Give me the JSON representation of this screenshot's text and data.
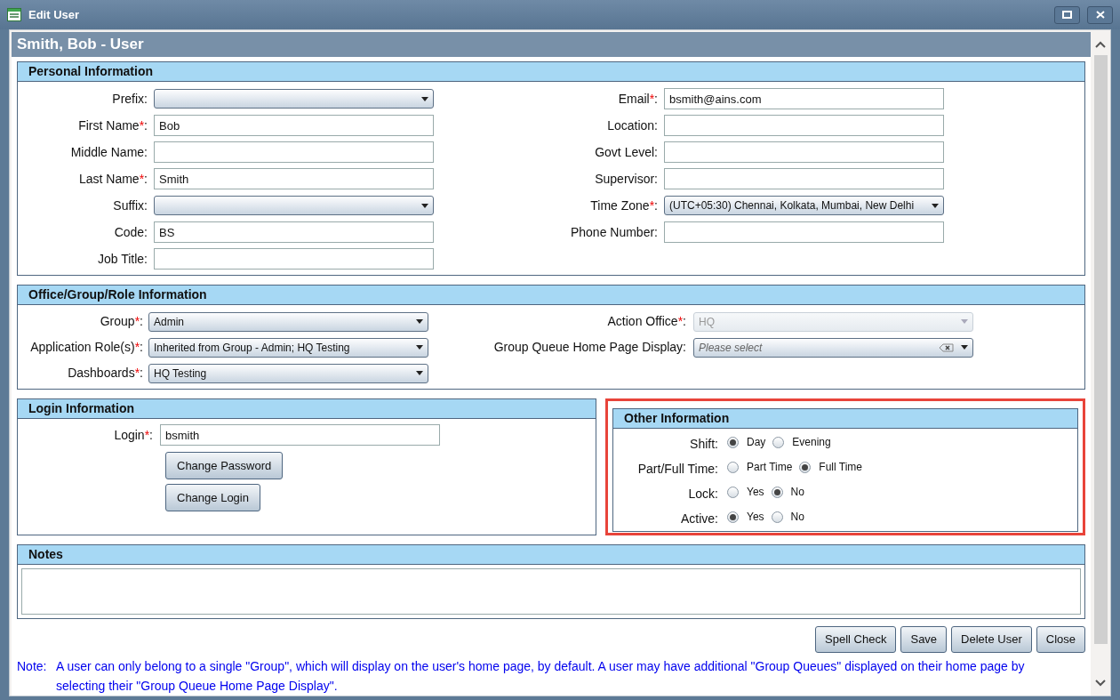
{
  "window": {
    "title": "Edit User"
  },
  "header": {
    "title": "Smith, Bob - User"
  },
  "personal": {
    "title": "Personal Information",
    "left_fields": [
      {
        "label": "Prefix:",
        "kind": "select"
      },
      {
        "label": "First Name",
        "required_mark": "*",
        "label_end": ":",
        "kind": "text",
        "value": "Bob"
      },
      {
        "label": "Middle Name:",
        "kind": "text"
      },
      {
        "label": "Last Name",
        "required_mark": "*",
        "label_end": ":",
        "kind": "text",
        "value": "Smith"
      },
      {
        "label": "Suffix:",
        "kind": "select"
      },
      {
        "label": "Code:",
        "kind": "text",
        "value": "BS"
      },
      {
        "label": "Job Title:",
        "kind": "text"
      }
    ],
    "right_fields": [
      {
        "label": "Email",
        "required_mark": "*",
        "label_end": ":",
        "kind": "text",
        "value": "bsmith@ains.com"
      },
      {
        "label": "Location:",
        "kind": "text"
      },
      {
        "label": "Govt Level:",
        "kind": "text"
      },
      {
        "label": "Supervisor:",
        "kind": "text"
      },
      {
        "label": "Time Zone",
        "required_mark": "*",
        "label_end": ":",
        "kind": "select",
        "value": "(UTC+05:30) Chennai, Kolkata, Mumbai, New Delhi"
      },
      {
        "label": "Phone Number:",
        "kind": "text"
      }
    ]
  },
  "office": {
    "title": "Office/Group/Role Information",
    "left_fields": [
      {
        "label": "Group",
        "required_mark": "*",
        "label_end": ":",
        "kind": "select",
        "value": "Admin",
        "disabled": false
      },
      {
        "label": "Application Role(s)",
        "required_mark": "*",
        "label_end": ":",
        "kind": "select",
        "value": "Inherited from Group - Admin; HQ Testing",
        "disabled": false
      },
      {
        "label": "Dashboards",
        "required_mark": "*",
        "label_end": ":",
        "kind": "select",
        "value": "HQ Testing",
        "disabled": false
      }
    ],
    "right_fields": [
      {
        "label": "Action Office",
        "required_mark": "*",
        "label_end": ":",
        "kind": "select",
        "value": "HQ",
        "disabled": true
      },
      {
        "label": "Group Queue Home Page Display:",
        "kind": "clearable",
        "placeholder": "Please select",
        "disabled": false
      }
    ]
  },
  "login": {
    "title": "Login Information",
    "fields": [
      {
        "label": "Login",
        "required_mark": "*",
        "label_end": ":",
        "value": "bsmith"
      }
    ],
    "buttons": [
      "Change Password",
      "Change Login"
    ]
  },
  "other": {
    "title": "Other Information",
    "highlighted": true,
    "rows": [
      {
        "label": "Shift:",
        "options": [
          {
            "label": "Day",
            "selected": true
          },
          {
            "label": "Evening",
            "selected": false
          }
        ]
      },
      {
        "label": "Part/Full Time:",
        "options": [
          {
            "label": "Part Time",
            "selected": false
          },
          {
            "label": "Full Time",
            "selected": true
          }
        ]
      },
      {
        "label": "Lock:",
        "options": [
          {
            "label": "Yes",
            "selected": false
          },
          {
            "label": "No",
            "selected": true
          }
        ]
      },
      {
        "label": "Active:",
        "options": [
          {
            "label": "Yes",
            "selected": true
          },
          {
            "label": "No",
            "selected": false
          }
        ]
      }
    ]
  },
  "notes": {
    "title": "Notes"
  },
  "buttons": [
    "Spell Check",
    "Save",
    "Delete User",
    "Close"
  ],
  "note": {
    "prefix": "Note:",
    "text": "A user can only belong to a single \"Group\", which will display on the user's home page, by default. A user may have additional \"Group Queues\" displayed on their home page by selecting their \"Group Queue Home Page Display\"."
  }
}
